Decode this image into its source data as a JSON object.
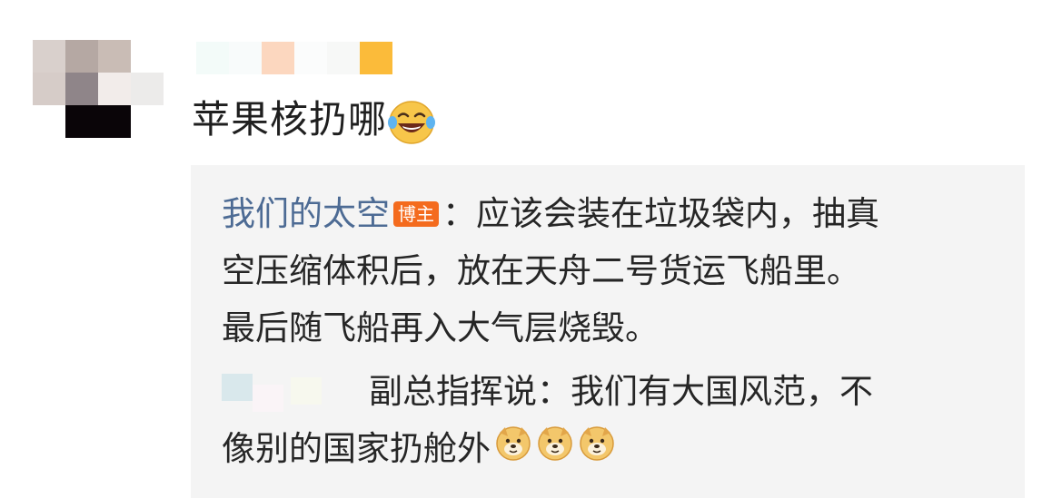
{
  "comment": {
    "text": "苹果核扔哪",
    "emoji": "laughing-tears-emoji"
  },
  "reply": {
    "author": "我们的太空",
    "badge": "博主",
    "separator": "：",
    "lines": [
      "应该会装在垃圾袋内，抽真",
      "空压缩体积后，放在天舟二号货运飞船里。",
      "最后随飞船再入大气层烧毁。"
    ]
  },
  "sub_reply": {
    "lines": [
      "副总指挥说：我们有大国风范，不",
      "像别的国家扔舱外"
    ],
    "emojis": [
      "doge-emoji",
      "doge-emoji",
      "doge-emoji"
    ]
  },
  "colors": {
    "author_link": "#4d6b94",
    "badge_bg": "#f46b1e",
    "reply_bg": "#f4f4f4"
  }
}
